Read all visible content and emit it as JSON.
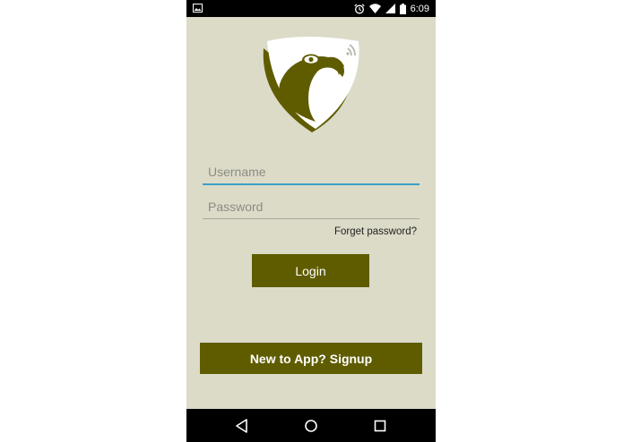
{
  "status_bar": {
    "time": "6:09",
    "icons": [
      "gallery-icon",
      "alarm-icon",
      "wifi-icon",
      "signal-icon",
      "battery-icon"
    ]
  },
  "login_form": {
    "username_placeholder": "Username",
    "password_placeholder": "Password",
    "forget_password_label": "Forget password?",
    "login_label": "Login",
    "signup_label": "New to App? Signup"
  },
  "nav_bar": {
    "icons": [
      "back-icon",
      "home-icon",
      "recents-icon"
    ]
  },
  "colors": {
    "background": "#dcdbc8",
    "primary": "#5f5c00",
    "focus_underline": "#3aa0c6"
  }
}
